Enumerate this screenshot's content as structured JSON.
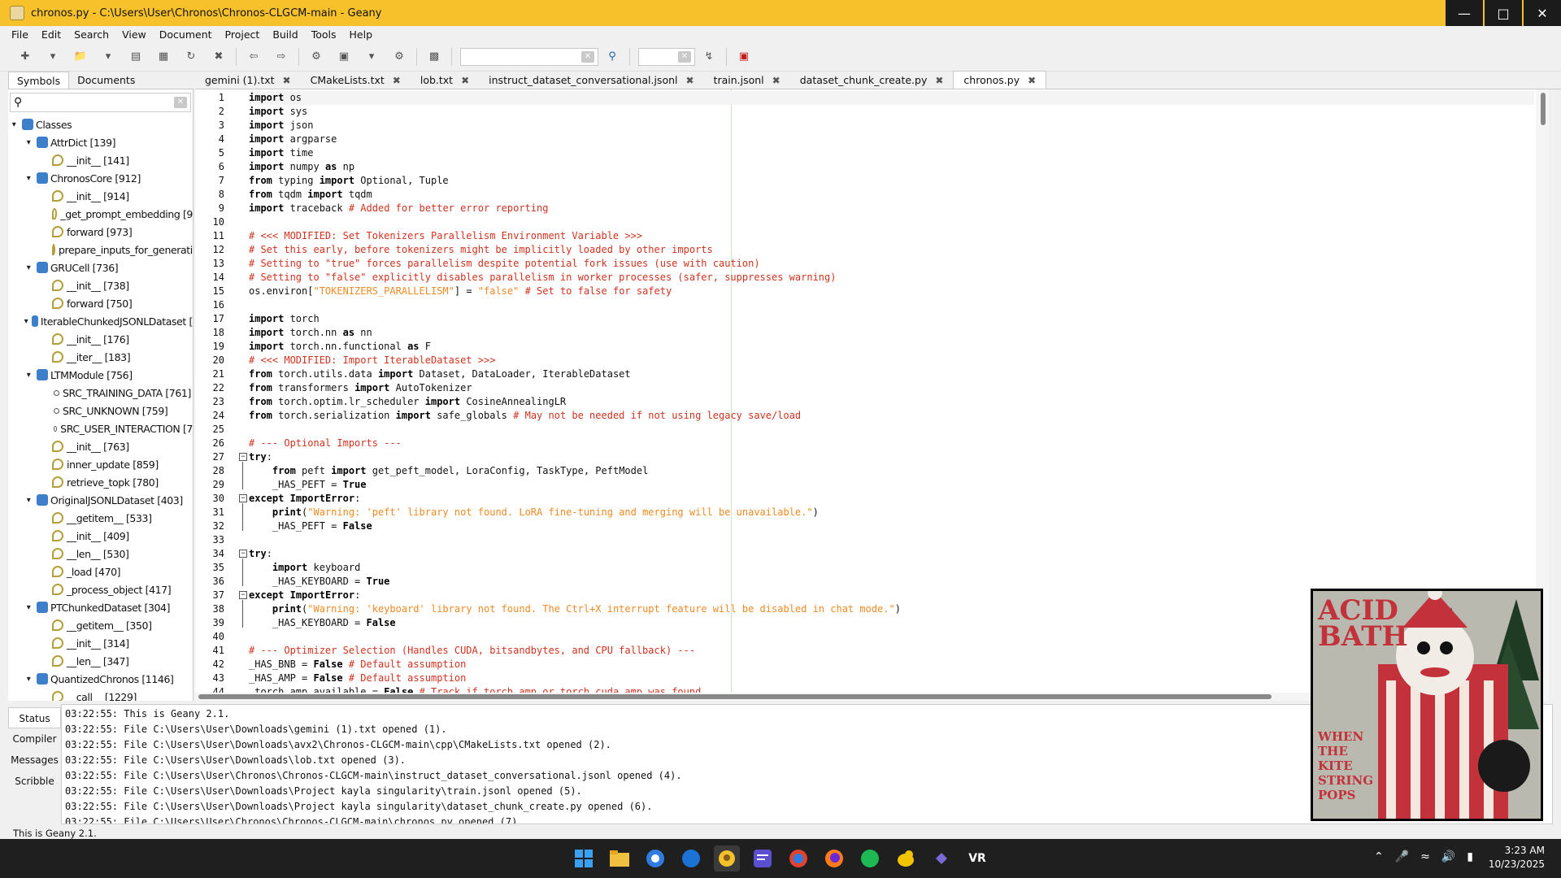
{
  "window": {
    "title": "chronos.py - C:\\Users\\User\\Chronos\\Chronos-CLGCM-main - Geany"
  },
  "menu": [
    "File",
    "Edit",
    "Search",
    "View",
    "Document",
    "Project",
    "Build",
    "Tools",
    "Help"
  ],
  "sidebar": {
    "tabs": [
      "Symbols",
      "Documents"
    ],
    "tree": [
      {
        "label": "Classes",
        "kind": "folder",
        "depth": 0
      },
      {
        "label": "AttrDict [139]",
        "kind": "class",
        "depth": 1
      },
      {
        "label": "__init__ [141]",
        "kind": "fn",
        "depth": 2
      },
      {
        "label": "ChronosCore [912]",
        "kind": "class",
        "depth": 1
      },
      {
        "label": "__init__ [914]",
        "kind": "fn",
        "depth": 2
      },
      {
        "label": "_get_prompt_embedding [9",
        "kind": "fn",
        "depth": 2
      },
      {
        "label": "forward [973]",
        "kind": "fn",
        "depth": 2
      },
      {
        "label": "prepare_inputs_for_generatio",
        "kind": "fn",
        "depth": 2
      },
      {
        "label": "GRUCell [736]",
        "kind": "class",
        "depth": 1
      },
      {
        "label": "__init__ [738]",
        "kind": "fn",
        "depth": 2
      },
      {
        "label": "forward [750]",
        "kind": "fn",
        "depth": 2
      },
      {
        "label": "IterableChunkedJSONLDataset [",
        "kind": "class",
        "depth": 1
      },
      {
        "label": "__init__ [176]",
        "kind": "fn",
        "depth": 2
      },
      {
        "label": "__iter__ [183]",
        "kind": "fn",
        "depth": 2
      },
      {
        "label": "LTMModule [756]",
        "kind": "class",
        "depth": 1
      },
      {
        "label": "SRC_TRAINING_DATA [761]",
        "kind": "var",
        "depth": 2
      },
      {
        "label": "SRC_UNKNOWN [759]",
        "kind": "var",
        "depth": 2
      },
      {
        "label": "SRC_USER_INTERACTION [7",
        "kind": "var",
        "depth": 2
      },
      {
        "label": "__init__ [763]",
        "kind": "fn",
        "depth": 2
      },
      {
        "label": "inner_update [859]",
        "kind": "fn",
        "depth": 2
      },
      {
        "label": "retrieve_topk [780]",
        "kind": "fn",
        "depth": 2
      },
      {
        "label": "OriginalJSONLDataset [403]",
        "kind": "class",
        "depth": 1
      },
      {
        "label": "__getitem__ [533]",
        "kind": "fn",
        "depth": 2
      },
      {
        "label": "__init__ [409]",
        "kind": "fn",
        "depth": 2
      },
      {
        "label": "__len__ [530]",
        "kind": "fn",
        "depth": 2
      },
      {
        "label": "_load [470]",
        "kind": "fn",
        "depth": 2
      },
      {
        "label": "_process_object [417]",
        "kind": "fn",
        "depth": 2
      },
      {
        "label": "PTChunkedDataset [304]",
        "kind": "class",
        "depth": 1
      },
      {
        "label": "__getitem__ [350]",
        "kind": "fn",
        "depth": 2
      },
      {
        "label": "__init__ [314]",
        "kind": "fn",
        "depth": 2
      },
      {
        "label": "__len__ [347]",
        "kind": "fn",
        "depth": 2
      },
      {
        "label": "QuantizedChronos [1146]",
        "kind": "class",
        "depth": 1
      },
      {
        "label": "__call__ [1229]",
        "kind": "fn",
        "depth": 2
      }
    ]
  },
  "tabs": [
    {
      "label": "gemini (1).txt",
      "active": false
    },
    {
      "label": "CMakeLists.txt",
      "active": false
    },
    {
      "label": "lob.txt",
      "active": false
    },
    {
      "label": "instruct_dataset_conversational.jsonl",
      "active": false
    },
    {
      "label": "train.jsonl",
      "active": false
    },
    {
      "label": "dataset_chunk_create.py",
      "active": false
    },
    {
      "label": "chronos.py",
      "active": true
    }
  ],
  "code": [
    [
      [
        "kw",
        "import"
      ],
      [
        "t",
        " os"
      ]
    ],
    [
      [
        "kw",
        "import"
      ],
      [
        "t",
        " sys"
      ]
    ],
    [
      [
        "kw",
        "import"
      ],
      [
        "t",
        " json"
      ]
    ],
    [
      [
        "kw",
        "import"
      ],
      [
        "t",
        " argparse"
      ]
    ],
    [
      [
        "kw",
        "import"
      ],
      [
        "t",
        " time"
      ]
    ],
    [
      [
        "kw",
        "import"
      ],
      [
        "t",
        " numpy "
      ],
      [
        "kw",
        "as"
      ],
      [
        "t",
        " np"
      ]
    ],
    [
      [
        "kw",
        "from"
      ],
      [
        "t",
        " typing "
      ],
      [
        "kw",
        "import"
      ],
      [
        "t",
        " Optional, Tuple"
      ]
    ],
    [
      [
        "kw",
        "from"
      ],
      [
        "t",
        " tqdm "
      ],
      [
        "kw",
        "import"
      ],
      [
        "t",
        " tqdm"
      ]
    ],
    [
      [
        "kw",
        "import"
      ],
      [
        "t",
        " traceback "
      ],
      [
        "cm",
        "# Added for better error reporting"
      ]
    ],
    [],
    [
      [
        "cm",
        "# <<< MODIFIED: Set Tokenizers Parallelism Environment Variable >>>"
      ]
    ],
    [
      [
        "cm",
        "# Set this early, before tokenizers might be implicitly loaded by other imports"
      ]
    ],
    [
      [
        "cm",
        "# Setting to \"true\" forces parallelism despite potential fork issues (use with caution)"
      ]
    ],
    [
      [
        "cm",
        "# Setting to \"false\" explicitly disables parallelism in worker processes (safer, suppresses warning)"
      ]
    ],
    [
      [
        "t",
        "os.environ["
      ],
      [
        "st",
        "\"TOKENIZERS_PARALLELISM\""
      ],
      [
        "t",
        "] = "
      ],
      [
        "st",
        "\"false\""
      ],
      [
        "t",
        " "
      ],
      [
        "cm",
        "# Set to false for safety"
      ]
    ],
    [],
    [
      [
        "kw",
        "import"
      ],
      [
        "t",
        " torch"
      ]
    ],
    [
      [
        "kw",
        "import"
      ],
      [
        "t",
        " torch.nn "
      ],
      [
        "kw",
        "as"
      ],
      [
        "t",
        " nn"
      ]
    ],
    [
      [
        "kw",
        "import"
      ],
      [
        "t",
        " torch.nn.functional "
      ],
      [
        "kw",
        "as"
      ],
      [
        "t",
        " F"
      ]
    ],
    [
      [
        "cm",
        "# <<< MODIFIED: Import IterableDataset >>>"
      ]
    ],
    [
      [
        "kw",
        "from"
      ],
      [
        "t",
        " torch.utils.data "
      ],
      [
        "kw",
        "import"
      ],
      [
        "t",
        " Dataset, DataLoader, IterableDataset"
      ]
    ],
    [
      [
        "kw",
        "from"
      ],
      [
        "t",
        " transformers "
      ],
      [
        "kw",
        "import"
      ],
      [
        "t",
        " AutoTokenizer"
      ]
    ],
    [
      [
        "kw",
        "from"
      ],
      [
        "t",
        " torch.optim.lr_scheduler "
      ],
      [
        "kw",
        "import"
      ],
      [
        "t",
        " CosineAnnealingLR"
      ]
    ],
    [
      [
        "kw",
        "from"
      ],
      [
        "t",
        " torch.serialization "
      ],
      [
        "kw",
        "import"
      ],
      [
        "t",
        " safe_globals "
      ],
      [
        "cm",
        "# May not be needed if not using legacy save/load"
      ]
    ],
    [],
    [
      [
        "cm",
        "# --- Optional Imports ---"
      ]
    ],
    [
      [
        "kw",
        "try"
      ],
      [
        "t",
        ":"
      ]
    ],
    [
      [
        "t",
        "    "
      ],
      [
        "kw",
        "from"
      ],
      [
        "t",
        " peft "
      ],
      [
        "kw",
        "import"
      ],
      [
        "t",
        " get_peft_model, LoraConfig, TaskType, PeftModel"
      ]
    ],
    [
      [
        "t",
        "    _HAS_PEFT = "
      ],
      [
        "kw",
        "True"
      ]
    ],
    [
      [
        "kw",
        "except"
      ],
      [
        "t",
        " "
      ],
      [
        "kw",
        "ImportError"
      ],
      [
        "t",
        ":"
      ]
    ],
    [
      [
        "t",
        "    "
      ],
      [
        "kw",
        "print"
      ],
      [
        "t",
        "("
      ],
      [
        "st",
        "\"Warning: 'peft' library not found. LoRA fine-tuning and merging will be unavailable.\""
      ],
      [
        "t",
        ")"
      ]
    ],
    [
      [
        "t",
        "    _HAS_PEFT = "
      ],
      [
        "kw",
        "False"
      ]
    ],
    [],
    [
      [
        "kw",
        "try"
      ],
      [
        "t",
        ":"
      ]
    ],
    [
      [
        "t",
        "    "
      ],
      [
        "kw",
        "import"
      ],
      [
        "t",
        " keyboard"
      ]
    ],
    [
      [
        "t",
        "    _HAS_KEYBOARD = "
      ],
      [
        "kw",
        "True"
      ]
    ],
    [
      [
        "kw",
        "except"
      ],
      [
        "t",
        " "
      ],
      [
        "kw",
        "ImportError"
      ],
      [
        "t",
        ":"
      ]
    ],
    [
      [
        "t",
        "    "
      ],
      [
        "kw",
        "print"
      ],
      [
        "t",
        "("
      ],
      [
        "st",
        "\"Warning: 'keyboard' library not found. The Ctrl+X interrupt feature will be disabled in chat mode.\""
      ],
      [
        "t",
        ")"
      ]
    ],
    [
      [
        "t",
        "    _HAS_KEYBOARD = "
      ],
      [
        "kw",
        "False"
      ]
    ],
    [],
    [
      [
        "cm",
        "# --- Optimizer Selection (Handles CUDA, bitsandbytes, and CPU fallback) ---"
      ]
    ],
    [
      [
        "t",
        "_HAS_BNB = "
      ],
      [
        "kw",
        "False"
      ],
      [
        "t",
        " "
      ],
      [
        "cm",
        "# Default assumption"
      ]
    ],
    [
      [
        "t",
        "_HAS_AMP = "
      ],
      [
        "kw",
        "False"
      ],
      [
        "t",
        " "
      ],
      [
        "cm",
        "# Default assumption"
      ]
    ],
    [
      [
        "t",
        "_torch_amp_available = "
      ],
      [
        "kw",
        "False"
      ],
      [
        "t",
        " "
      ],
      [
        "cm",
        "# Track if torch.amp or torch.cuda.amp was found"
      ]
    ]
  ],
  "messages": {
    "tabs": [
      "Status",
      "Compiler",
      "Messages",
      "Scribble"
    ],
    "lines": [
      "03:22:55: This is Geany 2.1.",
      "03:22:55: File C:\\Users\\User\\Downloads\\gemini (1).txt opened (1).",
      "03:22:55: File C:\\Users\\User\\Downloads\\avx2\\Chronos-CLGCM-main\\cpp\\CMakeLists.txt opened (2).",
      "03:22:55: File C:\\Users\\User\\Downloads\\lob.txt opened (3).",
      "03:22:55: File C:\\Users\\User\\Chronos\\Chronos-CLGCM-main\\instruct_dataset_conversational.jsonl opened (4).",
      "03:22:55: File C:\\Users\\User\\Downloads\\Project kayla singularity\\train.jsonl opened (5).",
      "03:22:55: File C:\\Users\\User\\Downloads\\Project kayla singularity\\dataset_chunk_create.py opened (6).",
      "03:22:55: File C:\\Users\\User\\Chronos\\Chronos-CLGCM-main\\chronos.py opened (7)."
    ]
  },
  "statusbar": {
    "text": "This is Geany 2.1."
  },
  "album": {
    "logo": "ACID BATH",
    "subtitle": "WHEN THE KITE STRING POPS"
  },
  "taskbar": {
    "time": "3:23 AM",
    "date": "10/23/2025",
    "vr": "VR"
  }
}
